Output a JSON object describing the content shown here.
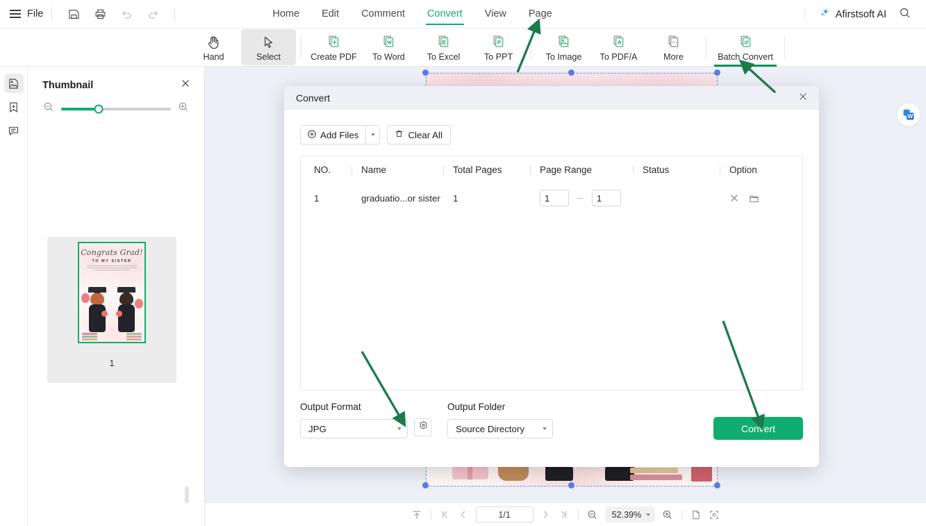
{
  "topbar": {
    "file_label": "File",
    "icons": [
      "menu-icon",
      "save-icon",
      "print-icon",
      "undo-icon",
      "redo-icon"
    ],
    "tabs": [
      {
        "label": "Home",
        "active": false
      },
      {
        "label": "Edit",
        "active": false
      },
      {
        "label": "Comment",
        "active": false
      },
      {
        "label": "Convert",
        "active": true
      },
      {
        "label": "View",
        "active": false
      },
      {
        "label": "Page",
        "active": false
      }
    ],
    "ai_label": "Afirstsoft AI",
    "search_icon": "search-icon",
    "sparkle_icon": "sparkle-icon"
  },
  "ribbon": {
    "items": [
      {
        "label": "Hand",
        "icon": "hand-icon",
        "selected": false,
        "underlined": false
      },
      {
        "label": "Select",
        "icon": "cursor-icon",
        "selected": true,
        "underlined": false
      },
      {
        "label": "Create PDF",
        "icon": "create-pdf-icon",
        "selected": false,
        "underlined": false
      },
      {
        "label": "To Word",
        "icon": "to-word-icon",
        "selected": false,
        "underlined": false
      },
      {
        "label": "To Excel",
        "icon": "to-excel-icon",
        "selected": false,
        "underlined": false
      },
      {
        "label": "To PPT",
        "icon": "to-ppt-icon",
        "selected": false,
        "underlined": false
      },
      {
        "label": "To Image",
        "icon": "to-image-icon",
        "selected": false,
        "underlined": false
      },
      {
        "label": "To PDF/A",
        "icon": "to-pdfa-icon",
        "selected": false,
        "underlined": false
      },
      {
        "label": "More",
        "icon": "more-icon",
        "selected": false,
        "underlined": false
      },
      {
        "label": "Batch Convert",
        "icon": "batch-convert-icon",
        "selected": false,
        "underlined": true
      }
    ]
  },
  "rail": {
    "items": [
      {
        "name": "thumbnail-panel-icon",
        "active": true
      },
      {
        "name": "bookmark-panel-icon",
        "active": false
      },
      {
        "name": "comment-panel-icon",
        "active": false
      }
    ]
  },
  "thumbnail_panel": {
    "title": "Thumbnail",
    "close_icon": "close-icon",
    "zoom_out_icon": "zoom-out-icon",
    "zoom_in_icon": "zoom-in-icon",
    "slider_value": 34,
    "page_number": "1",
    "artwork": {
      "headline": "Congrats Grad!",
      "subhead": "TO MY SISTER"
    }
  },
  "dialog": {
    "title": "Convert",
    "close_icon": "close-icon",
    "add_files_label": "Add Files",
    "add_files_icon": "plus-circle-icon",
    "add_files_caret_icon": "chevron-down-icon",
    "clear_all_label": "Clear All",
    "clear_all_icon": "trash-icon",
    "table": {
      "headers": [
        "NO.",
        "Name",
        "Total Pages",
        "Page Range",
        "Status",
        "Option"
      ],
      "rows": [
        {
          "no": "1",
          "name": "graduatio...or sister",
          "total_pages": "1",
          "range_from": "1",
          "range_to": "1",
          "status": "",
          "remove_icon": "close-icon",
          "folder_icon": "folder-icon"
        }
      ]
    },
    "output_format_label": "Output Format",
    "output_format_value": "JPG",
    "output_folder_label": "Output Folder",
    "output_folder_value": "Source Directory",
    "settings_icon": "gear-icon",
    "convert_label": "Convert"
  },
  "statusbar": {
    "fit_icon": "fit-page-icon",
    "first_icon": "first-page-icon",
    "prev_icon": "prev-page-icon",
    "page_value": "1/1",
    "next_icon": "next-page-icon",
    "last_icon": "last-page-icon",
    "zoom_out_icon": "zoom-out-icon",
    "zoom_value": "52.39%",
    "zoom_in_icon": "zoom-in-icon",
    "single_page_icon": "single-page-icon",
    "fit_screen_icon": "fit-screen-icon"
  },
  "canvas": {
    "wbadge_icon": "word-badge-icon"
  },
  "colors": {
    "accent_green": "#0fae6e",
    "annotation_green": "#1d7a4c",
    "dialog_header": "#eef0f5",
    "canvas_bg": "#eef0f7",
    "selection_blue": "#5b7be8"
  }
}
